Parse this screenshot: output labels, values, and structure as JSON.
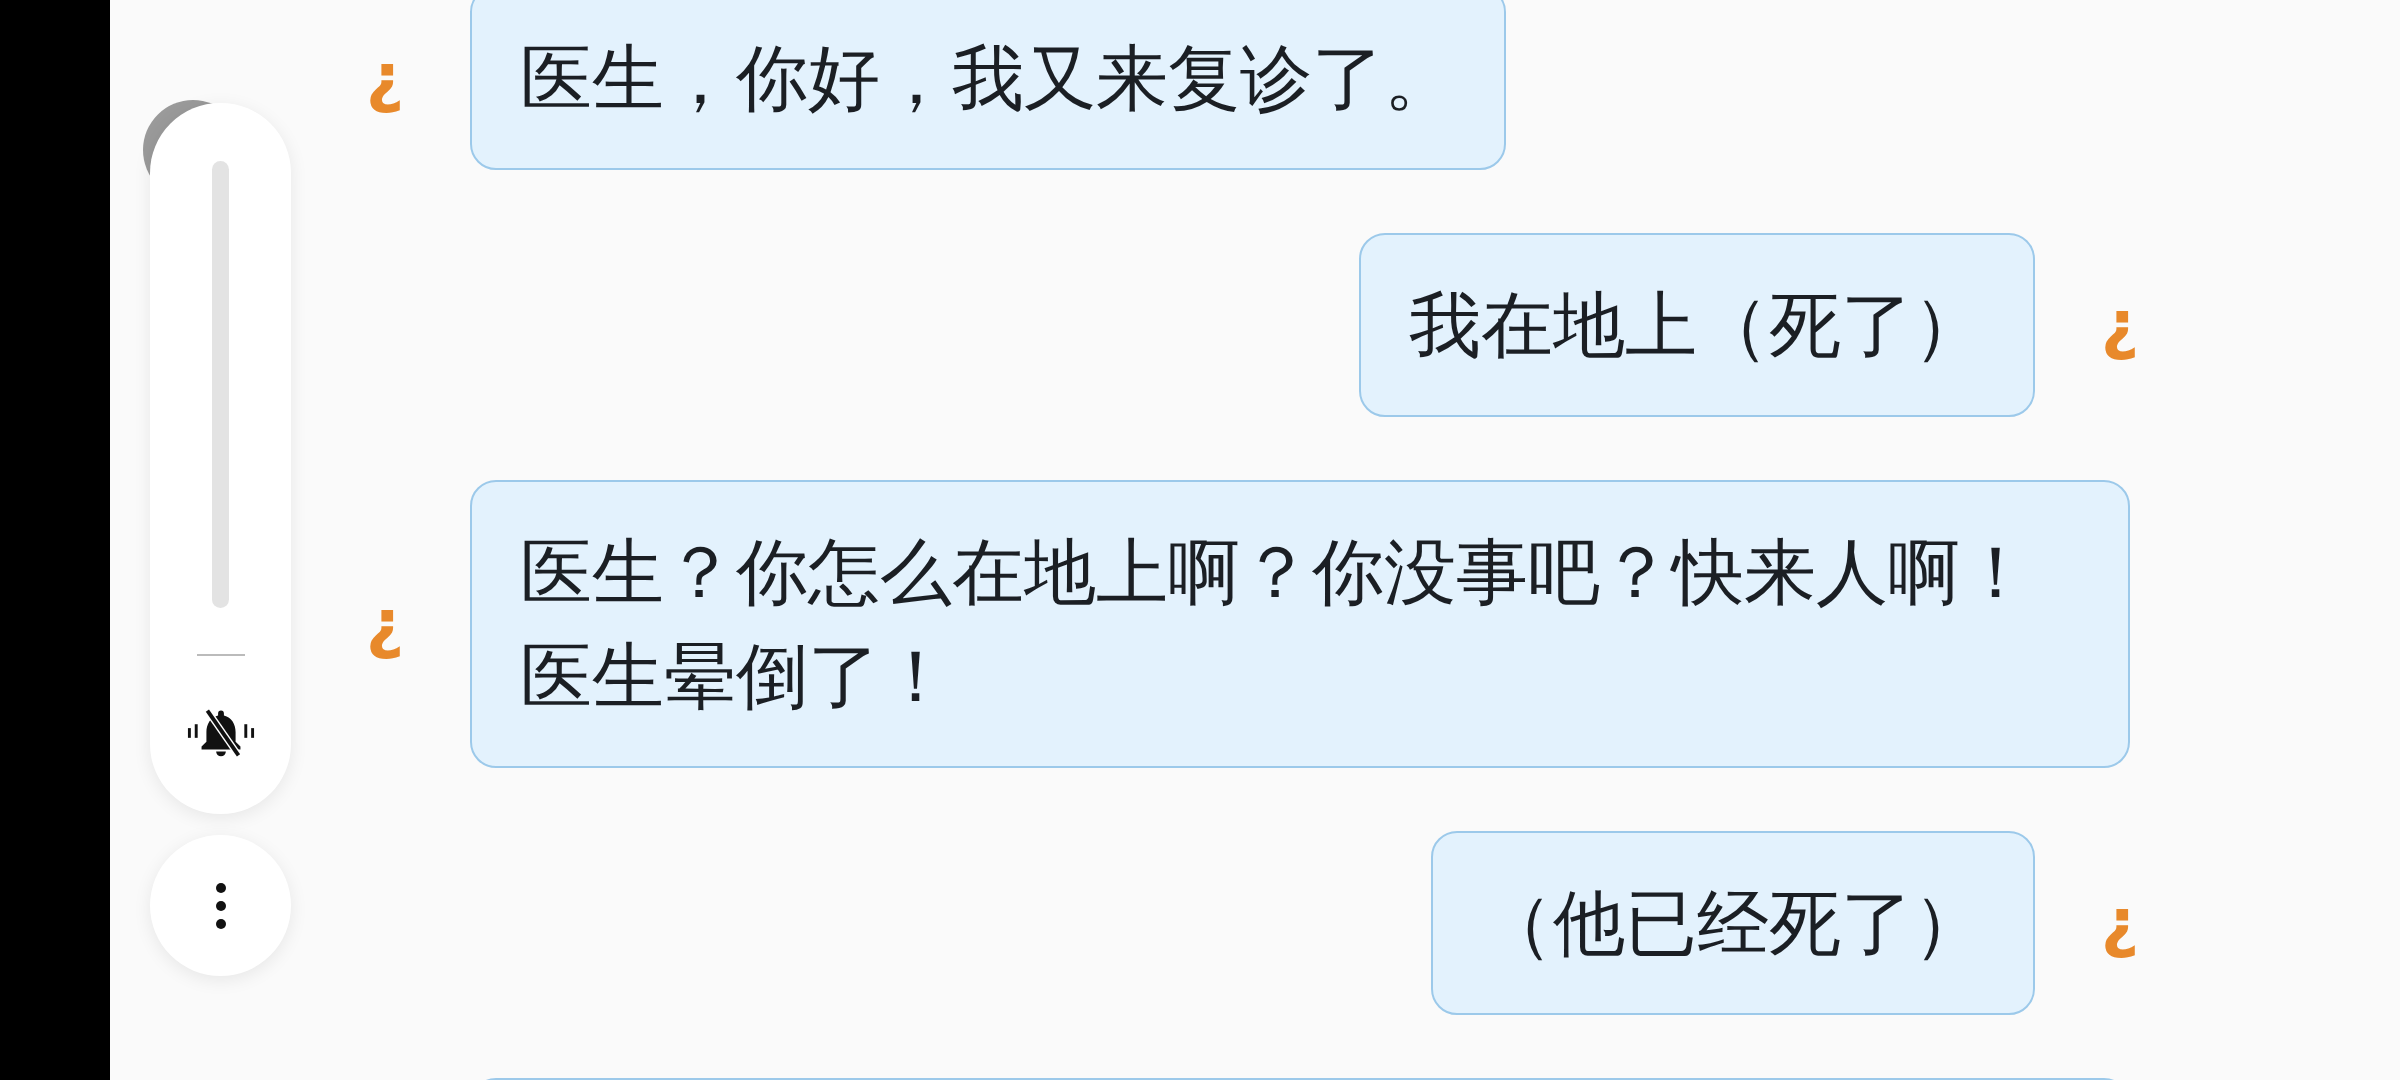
{
  "messages": [
    {
      "kind": "incoming",
      "avatar": "¿",
      "text": "医生，你好，我又来复诊了。"
    },
    {
      "kind": "outgoing",
      "avatar": "¿",
      "text": "我在地上（死了）"
    },
    {
      "kind": "incoming",
      "avatar": "¿",
      "text": "医生？你怎么在地上啊？你没事吧？快来人啊！医生晕倒了！"
    },
    {
      "kind": "outgoing",
      "avatar": "¿",
      "text": "（他已经死了）"
    },
    {
      "kind": "incoming"
    }
  ],
  "volume_panel": {
    "level": 0,
    "muted": true
  }
}
